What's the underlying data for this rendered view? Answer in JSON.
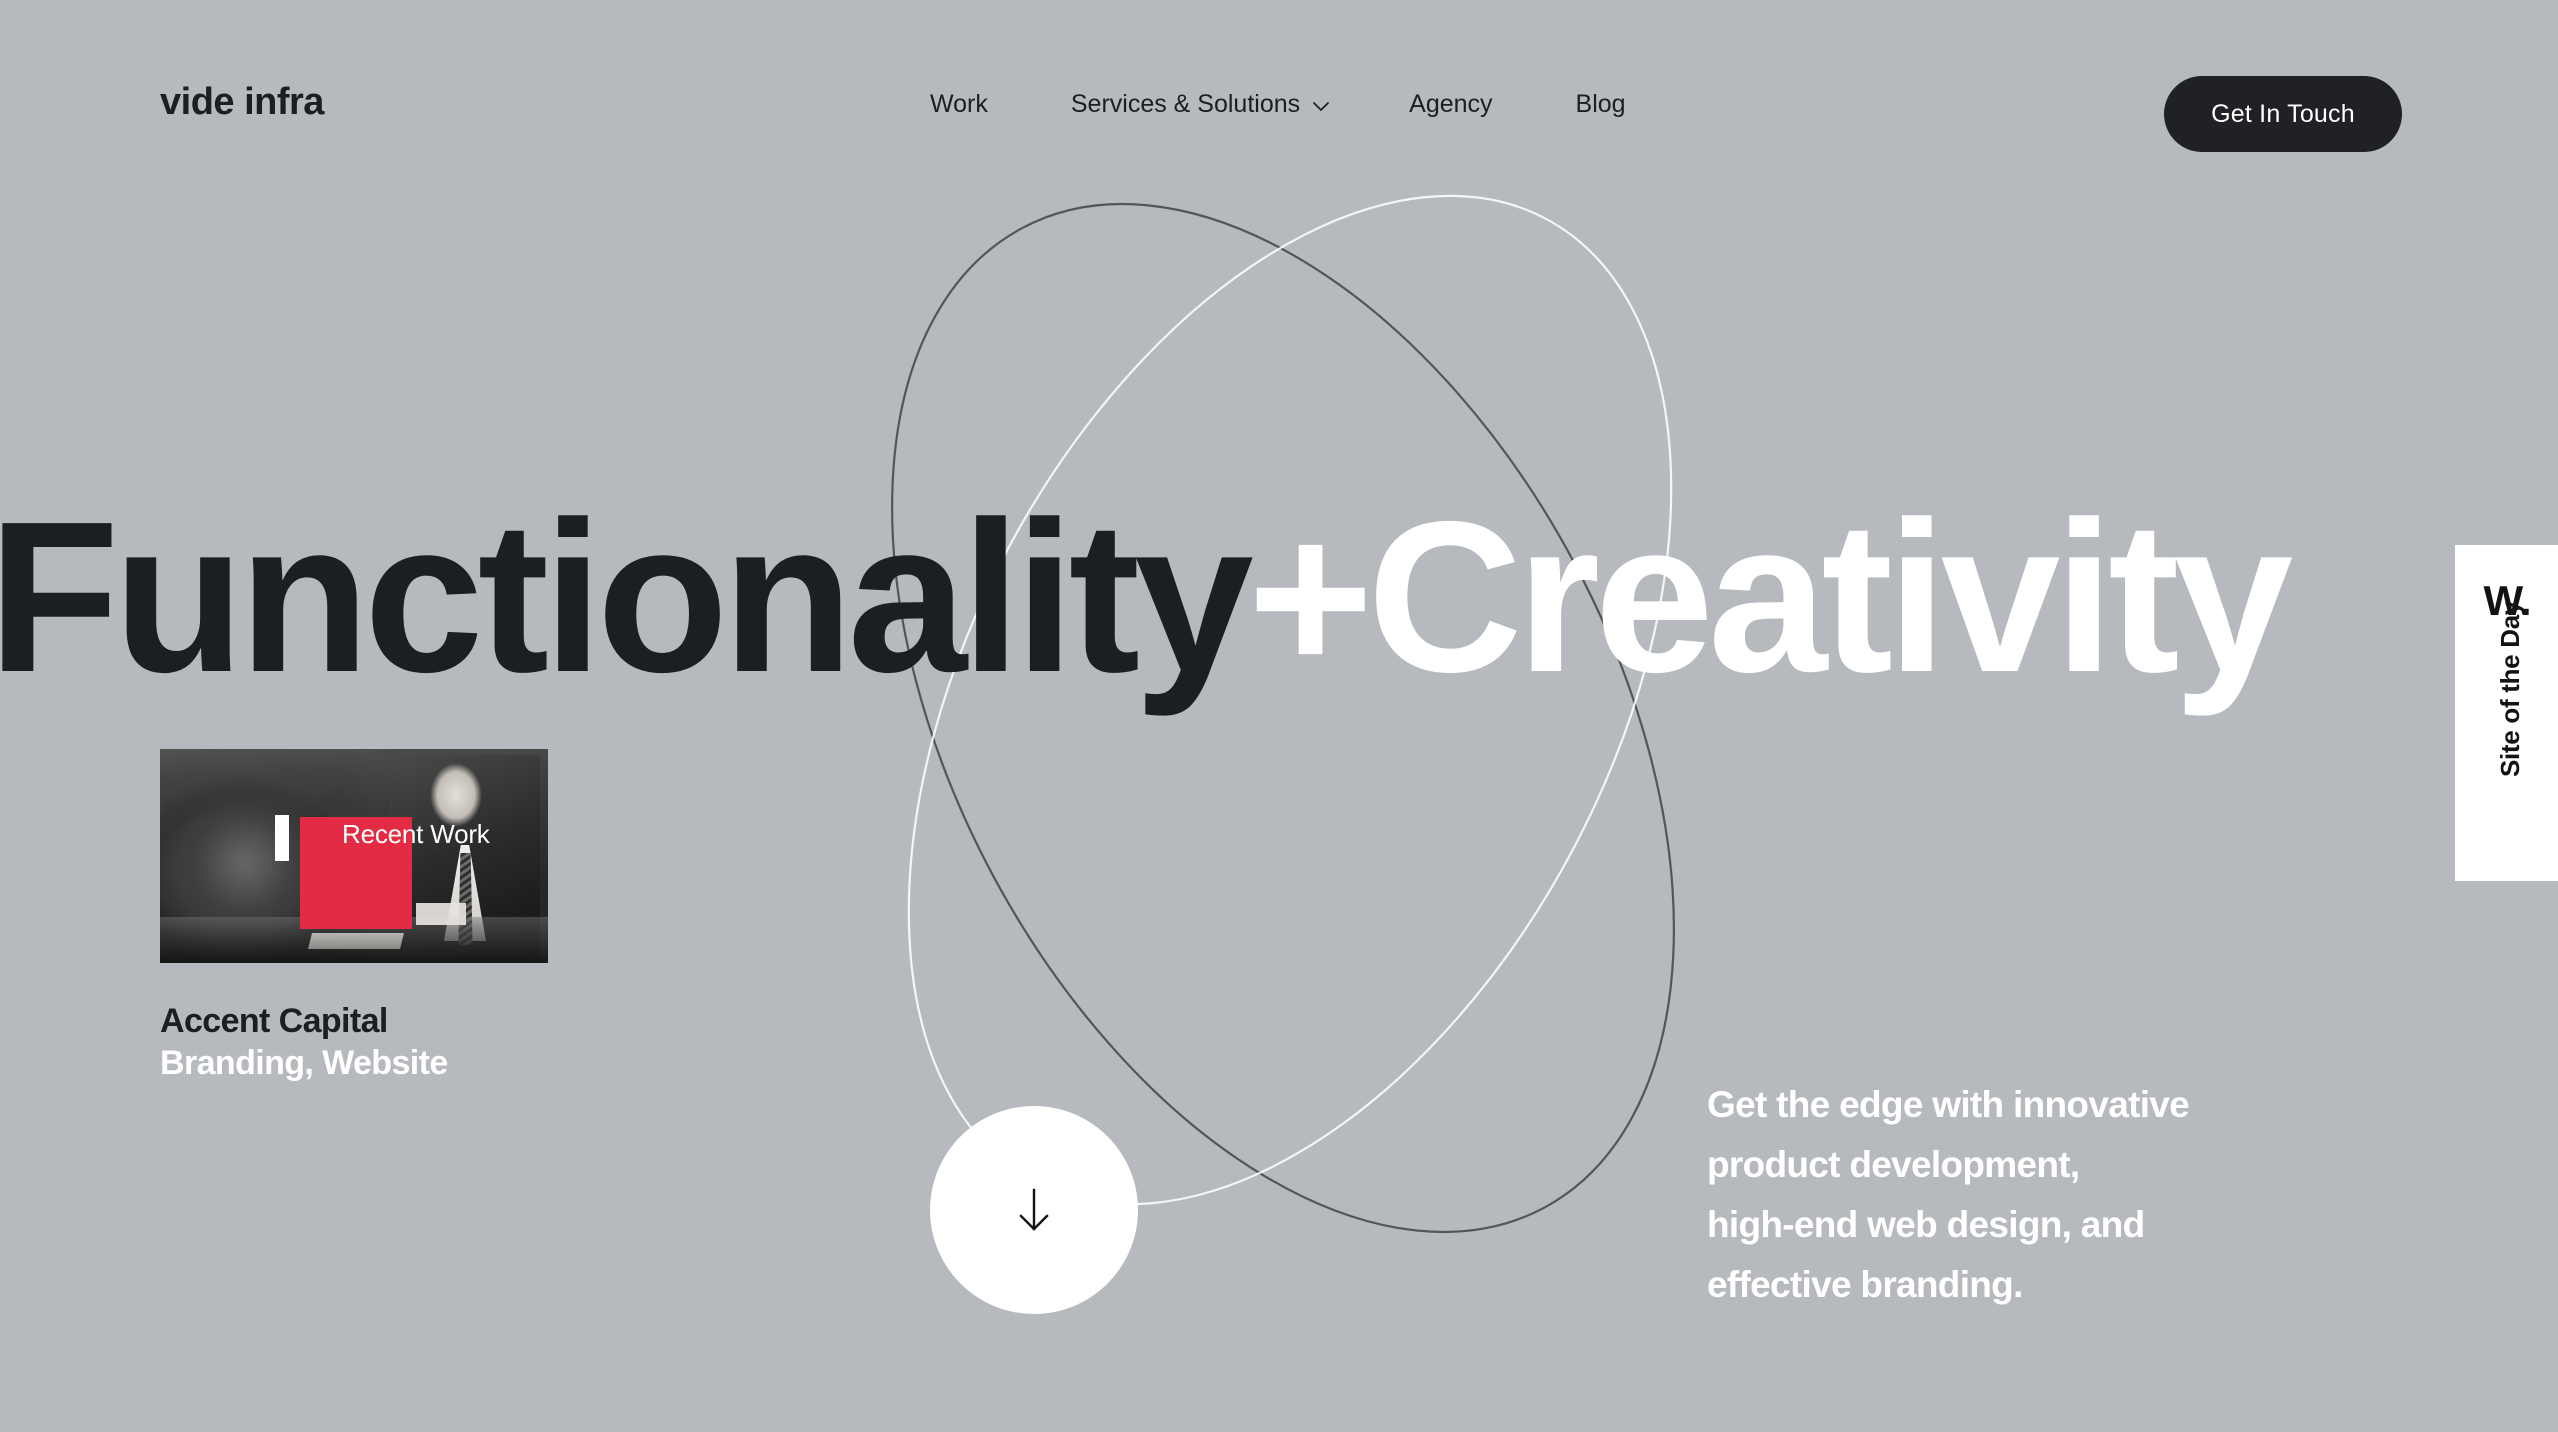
{
  "brand": {
    "logo": "vide infra"
  },
  "nav": {
    "items": [
      {
        "label": "Work",
        "has_dropdown": false
      },
      {
        "label": "Services & Solutions",
        "has_dropdown": true,
        "icon": "chevron-down-icon"
      },
      {
        "label": "Agency",
        "has_dropdown": false
      },
      {
        "label": "Blog",
        "has_dropdown": false
      }
    ],
    "cta": {
      "label": "Get In Touch"
    }
  },
  "hero": {
    "headline_dark": "Functionality",
    "headline_plus": "+",
    "headline_light": "Creativity",
    "scroll_icon": "arrow-down-icon"
  },
  "work_card": {
    "overlay_label": "Recent Work",
    "title": "Accent Capital",
    "subtitle": "Branding, Website",
    "accent_color": "#e32c43"
  },
  "tagline": {
    "line1": "Get the edge with innovative",
    "line2": "product development,",
    "line3": "high-end web design, and",
    "line4": "effective branding."
  },
  "award_badge": {
    "mark": "W.",
    "label": "Site of the Day"
  },
  "theme": {
    "background": "#b6b9be",
    "dark": "#1c1f22",
    "light": "#ffffff",
    "accent": "#e32c43"
  }
}
